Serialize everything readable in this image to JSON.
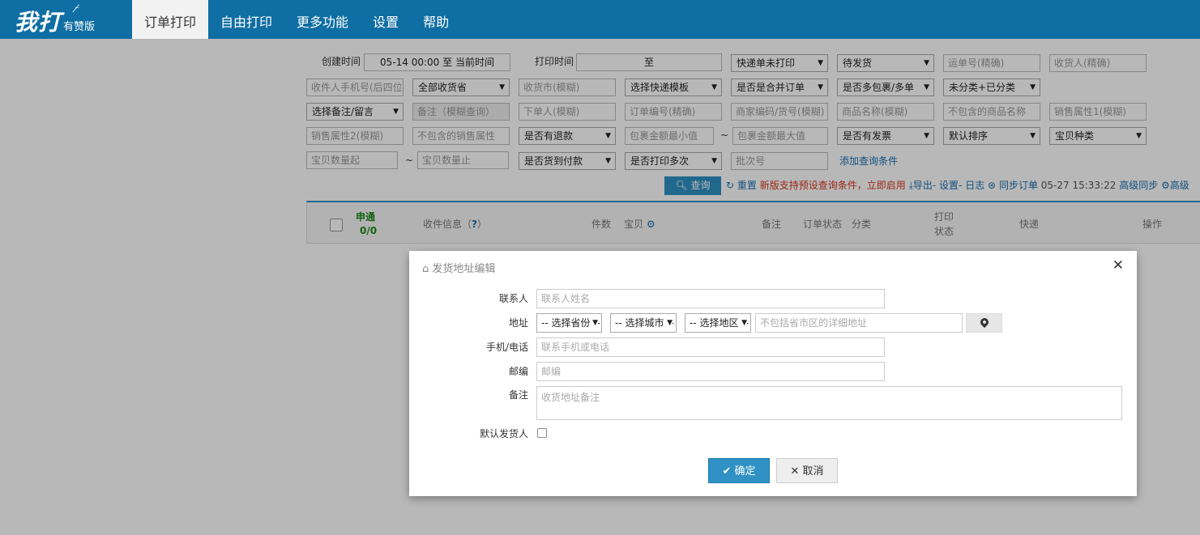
{
  "header": {
    "logo_main": "我打",
    "logo_sub": "有赞版",
    "nav": [
      {
        "label": "订单打印",
        "active": true
      },
      {
        "label": "自由打印"
      },
      {
        "label": "更多功能"
      },
      {
        "label": "设置"
      },
      {
        "label": "帮助"
      }
    ]
  },
  "filters": {
    "create_time_label": "创建时间",
    "create_time_value": "05-14 00:00 至 当前时间",
    "print_time_label": "打印时间",
    "print_time_value": "至",
    "express_unprinted": "快递单未打印",
    "status": "待发货",
    "waybill_ph": "运单号(精确)",
    "receiver_ph": "收货人(精确)",
    "phone_ph": "收件人手机号(后四位",
    "province": "全部收货省",
    "city_ph": "收货市(模糊)",
    "express_template": "选择快递模板",
    "merged": "是否是合并订单",
    "multi_pkg": "是否多包裹/多单",
    "category": "未分类+已分类",
    "remark_select": "选择备注/留言",
    "remark_ph": "备注（模糊查询）",
    "buyer_ph": "下单人(模糊)",
    "order_no_ph": "订单编号(精确)",
    "merchant_code_ph": "商家编码/货号(模糊)",
    "product_name_ph": "商品名称(模糊)",
    "exclude_product_ph": "不包含的商品名称",
    "sale_attr1_ph": "销售属性1(模糊)",
    "sale_attr2_ph": "销售属性2(模糊)",
    "exclude_attr_ph": "不包含的销售属性",
    "refund": "是否有退款",
    "pkg_min_ph": "包裹金额最小值",
    "tilde": "~",
    "pkg_max_ph": "包裹金额最大值",
    "invoice": "是否有发票",
    "sort": "默认排序",
    "item_kind": "宝贝种类",
    "qty_from_ph": "宝贝数量起",
    "qty_to_ph": "宝贝数量止",
    "cod": "是否货到付款",
    "printed_multi": "是否打印多次",
    "batch_ph": "批次号",
    "add_condition": "添加查询条件"
  },
  "toolbar": {
    "query": "查询",
    "reset": "重置",
    "notice": "新版支持预设查询条件，立即启用",
    "export": "导出",
    "settings": "- 设置",
    "log": "- 日志",
    "sync": "同步订单",
    "sync_time": "05-27 15:33:22",
    "advanced_sync": "高级同步",
    "advanced_cut": "高级"
  },
  "table": {
    "carrier": "申通",
    "carrier_count": "0/0",
    "receiver_info": "收件信息（",
    "receiver_q": "?",
    "receiver_close": "）",
    "qty": "件数",
    "item": "宝贝",
    "remark": "备注",
    "order_status": "订单状态",
    "category": "分类",
    "print_status_1": "打印",
    "print_status_2": "状态",
    "express": "快递",
    "ops": "操作"
  },
  "modal": {
    "title": "发货地址编辑",
    "contact_label": "联系人",
    "contact_ph": "联系人姓名",
    "address_label": "地址",
    "province_sel": "-- 选择省份 --",
    "city_sel": "-- 选择城市 --",
    "district_sel": "-- 选择地区 --",
    "detail_ph": "不包括省市区的详细地址",
    "phone_label": "手机/电话",
    "phone_ph": "联系手机或电话",
    "zip_label": "邮编",
    "zip_ph": "邮编",
    "remark_label": "备注",
    "remark_ph": "收货地址备注",
    "default_label": "默认发货人",
    "ok": "确定",
    "cancel": "取消"
  }
}
